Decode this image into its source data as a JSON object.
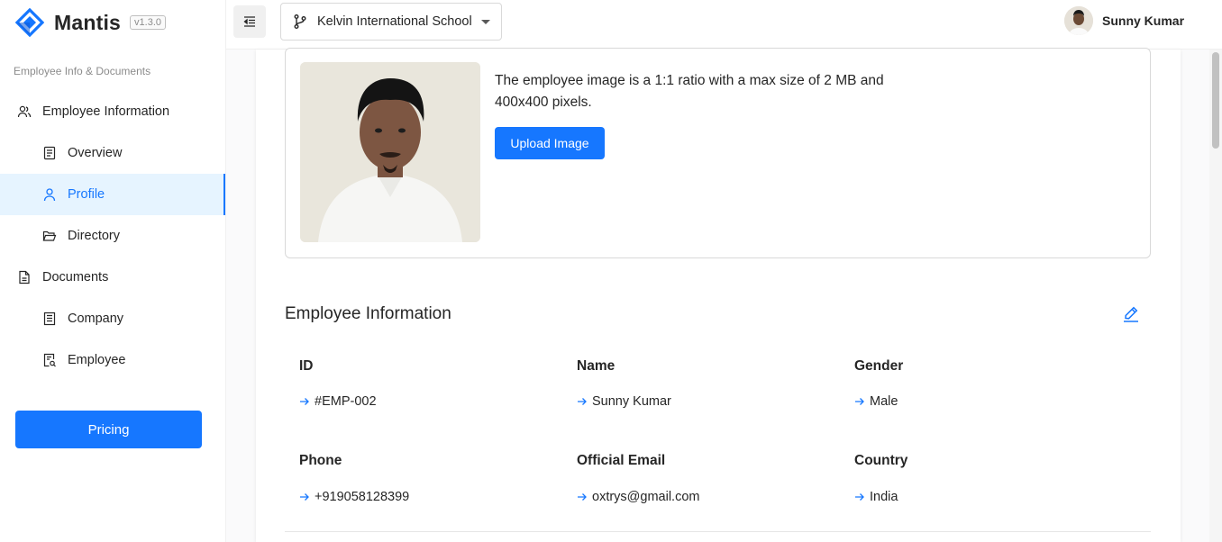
{
  "app": {
    "name": "Mantis",
    "version": "v1.3.0"
  },
  "sidebar": {
    "group_title": "Employee Info & Documents",
    "items": [
      {
        "label": "Employee Information",
        "icon": "users-icon"
      },
      {
        "label": "Overview",
        "icon": "file-text-icon"
      },
      {
        "label": "Profile",
        "icon": "user-icon",
        "active": true
      },
      {
        "label": "Directory",
        "icon": "folder-open-icon"
      },
      {
        "label": "Documents",
        "icon": "file-icon"
      },
      {
        "label": "Company",
        "icon": "building-icon"
      },
      {
        "label": "Employee",
        "icon": "file-search-icon"
      }
    ],
    "pricing_label": "Pricing"
  },
  "header": {
    "school": "Kelvin International School",
    "user_name": "Sunny Kumar"
  },
  "image_section": {
    "description": "The employee image is a 1:1 ratio with a max size of 2 MB and 400x400 pixels.",
    "upload_label": "Upload Image"
  },
  "employee_info": {
    "title": "Employee Information",
    "fields": [
      {
        "label": "ID",
        "value": "#EMP-002"
      },
      {
        "label": "Name",
        "value": "Sunny Kumar"
      },
      {
        "label": "Gender",
        "value": "Male"
      },
      {
        "label": "Phone",
        "value": "+919058128399"
      },
      {
        "label": "Official Email",
        "value": "oxtrys@gmail.com"
      },
      {
        "label": "Country",
        "value": "India"
      }
    ]
  },
  "colors": {
    "primary": "#1677ff",
    "active_bg": "#e6f4ff"
  }
}
